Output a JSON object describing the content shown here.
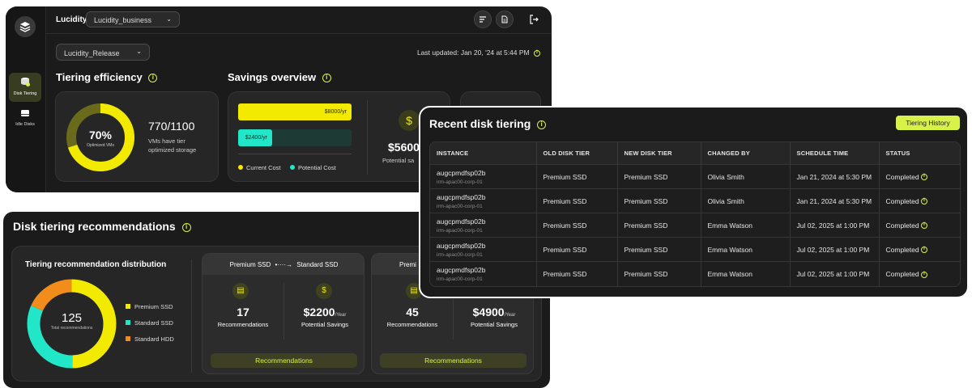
{
  "header": {
    "app_name": "Lucidity",
    "account_select": "Lucidity_business",
    "release_select": "Lucidity_Release",
    "last_updated": "Last updated: Jan 20, '24 at 5:44 PM"
  },
  "sidebar": {
    "items": [
      {
        "label": "Disk Tiering"
      },
      {
        "label": "Idle Disks"
      }
    ]
  },
  "efficiency": {
    "title": "Tiering efficiency",
    "percent": "70%",
    "percent_caption": "Optimized VMs",
    "fraction": "770/1100",
    "desc_line1": "VMs have tier",
    "desc_line2": "optimized storage",
    "ratio": 0.7
  },
  "savings": {
    "title": "Savings overview",
    "bar1_label": "$8000/yr",
    "bar1_value": 8000,
    "bar2_label": "$2400/yr",
    "bar2_value": 2400,
    "legend_current": "Current Cost",
    "legend_potential": "Potential Cost",
    "potential_amount": "$5600",
    "potential_label": "Potential sa",
    "colors": {
      "current": "#f2ea00",
      "potential": "#22e6c8"
    }
  },
  "recommendations": {
    "title": "Disk tiering recommendations",
    "dist_title": "Tiering recommendation distribution",
    "total": "125",
    "total_caption": "Total recommendations",
    "legend": [
      {
        "label": "Premium SSD",
        "color": "#f2ea00",
        "value": 62
      },
      {
        "label": "Standard SSD",
        "color": "#22e6c8",
        "value": 40
      },
      {
        "label": "Standard HDD",
        "color": "#f28c1a",
        "value": 23
      }
    ],
    "cards": [
      {
        "from": "Premium SSD",
        "to": "Standard SSD",
        "count": "17",
        "count_label": "Recommendations",
        "savings": "$2200",
        "per": "/Year",
        "savings_label": "Potential Savings",
        "button": "Recommendations"
      },
      {
        "from": "Premi",
        "to": "",
        "count": "45",
        "count_label": "Recommendations",
        "savings": "$4900",
        "per": "/Year",
        "savings_label": "Potential Savings",
        "button": "Recommendations"
      }
    ]
  },
  "recent": {
    "title": "Recent disk tiering",
    "history_button": "Tiering History",
    "columns": [
      "INSTANCE",
      "OLD DISK TIER",
      "NEW DISK TIER",
      "CHANGED BY",
      "SCHEDULE TIME",
      "STATUS"
    ],
    "rows": [
      {
        "instance": "augcpmdfsp02b",
        "group": "irm-apac00-corp-01",
        "old": "Premium SSD",
        "new": "Premium SSD",
        "by": "Olivia Smith",
        "time": "Jan 21, 2024 at 5:30 PM",
        "status": "Completed"
      },
      {
        "instance": "augcpmdfsp02b",
        "group": "irm-apac00-corp-01",
        "old": "Premium SSD",
        "new": "Premium SSD",
        "by": "Olivia Smith",
        "time": "Jan 21, 2024 at 5:30 PM",
        "status": "Completed"
      },
      {
        "instance": "augcpmdfsp02b",
        "group": "irm-apac00-corp-01",
        "old": "Premium SSD",
        "new": "Premium SSD",
        "by": "Emma Watson",
        "time": "Jul 02, 2025 at 1:00 PM",
        "status": "Completed"
      },
      {
        "instance": "augcpmdfsp02b",
        "group": "irm-apac00-corp-01",
        "old": "Premium SSD",
        "new": "Premium SSD",
        "by": "Emma Watson",
        "time": "Jul 02, 2025 at 1:00 PM",
        "status": "Completed"
      },
      {
        "instance": "augcpmdfsp02b",
        "group": "irm-apac00-corp-01",
        "old": "Premium SSD",
        "new": "Premium SSD",
        "by": "Emma Watson",
        "time": "Jul 02, 2025 at 1:00 PM",
        "status": "Completed"
      }
    ]
  }
}
